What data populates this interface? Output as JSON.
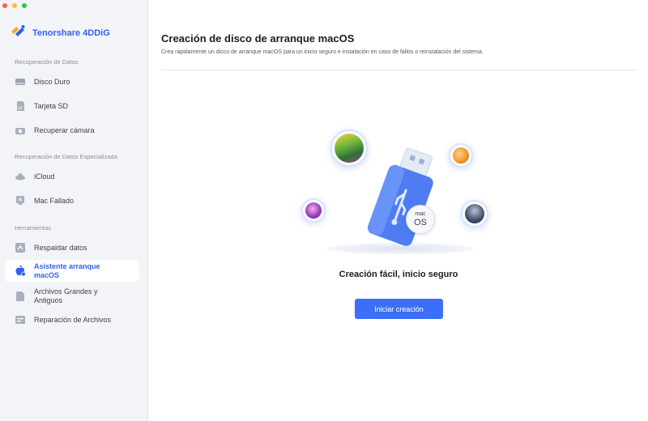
{
  "app": {
    "name": "Tenorshare 4DDiG"
  },
  "sidebar": {
    "sections": [
      {
        "label": "Recuperación de Datos"
      },
      {
        "label": "Recuperación de Datos Especializada"
      },
      {
        "label": "Herramientas"
      }
    ],
    "items": [
      {
        "label": "Disco Duro",
        "icon": "hard-drive-icon"
      },
      {
        "label": "Tarjeta SD",
        "icon": "sd-card-icon"
      },
      {
        "label": "Recuperar cámara",
        "icon": "camera-icon"
      },
      {
        "label": "iCloud",
        "icon": "cloud-icon"
      },
      {
        "label": "Mac Fallado",
        "icon": "crashed-mac-icon"
      },
      {
        "label": "Respaldar datos",
        "icon": "backup-icon"
      },
      {
        "label": "Asistente arranque macOS",
        "icon": "apple-icon",
        "active": true
      },
      {
        "label": "Archivos Grandes y Antiguos",
        "icon": "file-icon"
      },
      {
        "label": "Reparación de Archivos",
        "icon": "file-repair-icon"
      }
    ]
  },
  "main": {
    "title": "Creación de disco de arranque macOS",
    "subtitle": "Crea rápidamente un disco de arranque macOS para un inicio seguro e instalación en caso de fallos o reinstalación del sistema.",
    "usb_badge_line1": "mac",
    "usb_badge_line2": "OS",
    "headline": "Creación fácil, inicio seguro",
    "cta_label": "Iniciar creación"
  },
  "colors": {
    "accent": "#3b6ff6",
    "brand": "#2f62f0"
  }
}
